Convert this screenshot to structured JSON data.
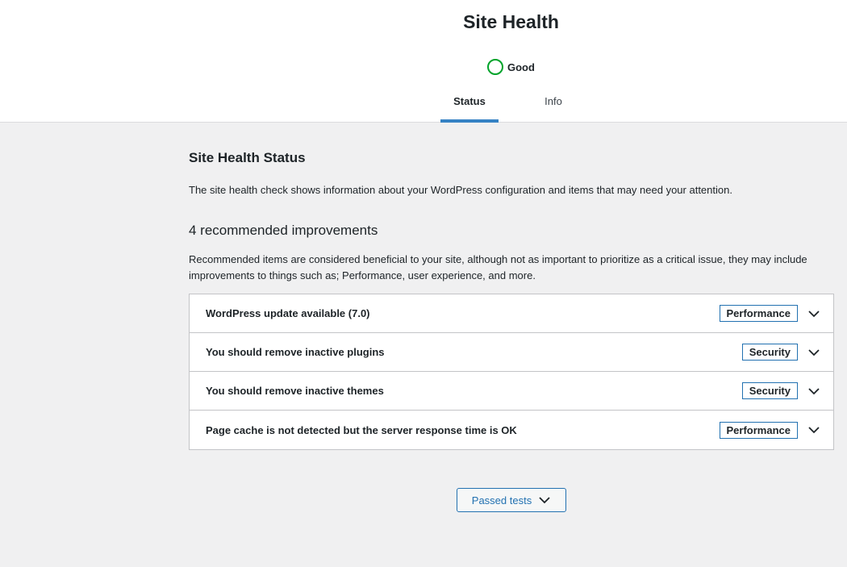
{
  "header": {
    "title": "Site Health",
    "health_status": "Good",
    "health_color": "#00a32a",
    "tabs": [
      {
        "label": "Status",
        "active": true
      },
      {
        "label": "Info",
        "active": false
      }
    ]
  },
  "main": {
    "section_title": "Site Health Status",
    "intro": "The site health check shows information about your WordPress configuration and items that may need your attention.",
    "improvements_title": "4 recommended improvements",
    "improvements_description": "Recommended items are considered beneficial to your site, although not as important to prioritize as a critical issue, they may include improvements to things such as; Performance, user experience, and more.",
    "issues": [
      {
        "title": "WordPress update available (7.0)",
        "badge": "Performance",
        "icon": "chevron-down-icon"
      },
      {
        "title": "You should remove inactive plugins",
        "badge": "Security",
        "icon": "chevron-down-icon"
      },
      {
        "title": "You should remove inactive themes",
        "badge": "Security",
        "icon": "chevron-down-icon"
      },
      {
        "title": "Page cache is not detected but the server response time is OK",
        "badge": "Performance",
        "icon": "chevron-down-icon"
      }
    ],
    "passed_tests_label": "Passed tests"
  },
  "colors": {
    "accent": "#2271b1",
    "tab_underline": "#3582c4",
    "good": "#00a32a"
  }
}
